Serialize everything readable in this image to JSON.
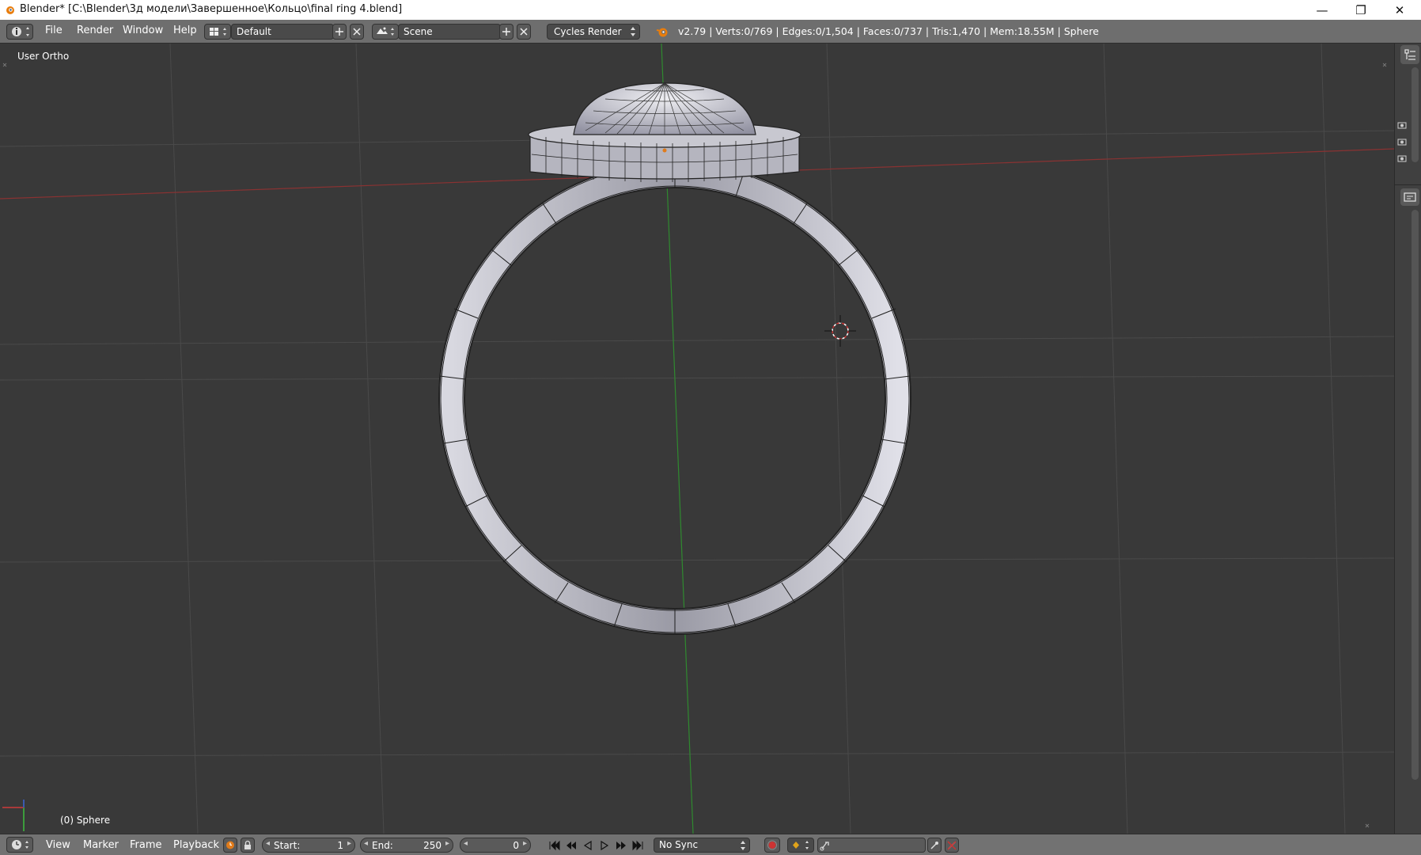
{
  "window": {
    "title": "Blender* [C:\\Blender\\3д модели\\Завершенное\\Кольцо\\final ring  4.blend]",
    "minimize_glyph": "—",
    "restore_glyph": "❐",
    "close_glyph": "✕"
  },
  "header": {
    "menus": [
      "File",
      "Render",
      "Window",
      "Help"
    ],
    "layout_name": "Default",
    "scene_name": "Scene",
    "render_engine": "Cycles Render",
    "stats": "v2.79 | Verts:0/769 | Edges:0/1,504 | Faces:0/737 | Tris:1,470 | Mem:18.55M | Sphere"
  },
  "viewport": {
    "view_label": "User Ortho",
    "object_label": "(0) Sphere"
  },
  "timeline": {
    "menus": [
      "View",
      "Marker",
      "Frame",
      "Playback"
    ],
    "start_label": "Start:",
    "start_value": "1",
    "end_label": "End:",
    "end_value": "250",
    "current_frame": "0",
    "sync_mode": "No Sync"
  },
  "colors": {
    "accent_orange": "#e07b1a",
    "x_axis": "#a83a3a",
    "y_axis": "#3c9c3c"
  }
}
